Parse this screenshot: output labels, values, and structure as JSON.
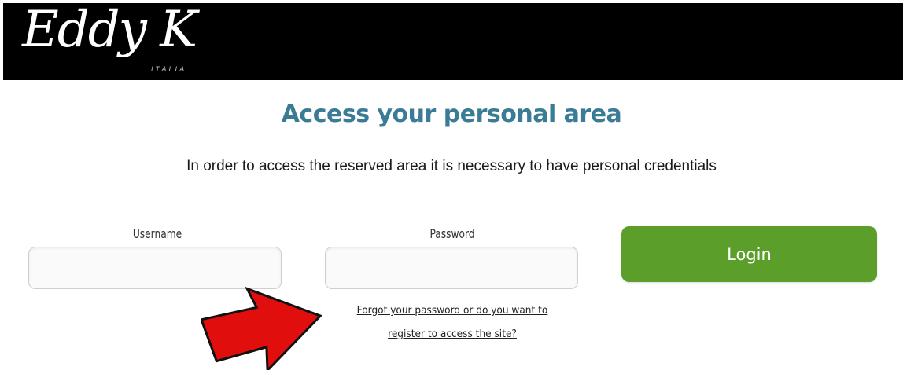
{
  "header": {
    "logo_text": "Eddy K",
    "logo_subtext": "ITALIA"
  },
  "main": {
    "title": "Access your personal area",
    "subtitle": "In order to access the reserved area it is necessary to have personal credentials"
  },
  "form": {
    "username_label": "Username",
    "username_value": "",
    "password_label": "Password",
    "password_value": "",
    "login_label": "Login",
    "forgot_line1": "Forgot your password or do you want to",
    "forgot_line2": "register to access the site?"
  },
  "annotation": {
    "arrow_icon": "right-arrow-icon",
    "arrow_color": "#e10e0e"
  },
  "colors": {
    "header_bg": "#000000",
    "title": "#3a7b96",
    "login_button": "#5b9f2a"
  }
}
